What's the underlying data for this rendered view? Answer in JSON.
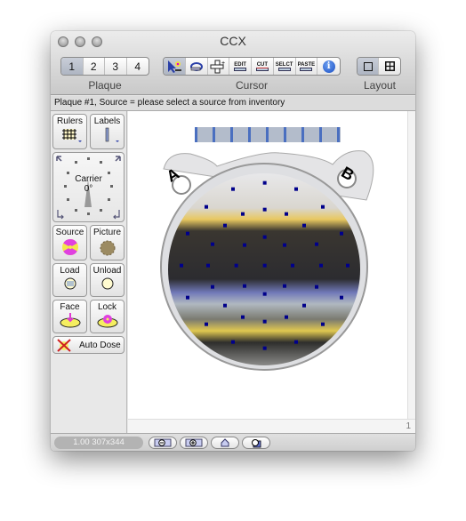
{
  "window": {
    "title": "CCX"
  },
  "toolbar": {
    "plaque": {
      "label": "Plaque",
      "items": [
        "1",
        "2",
        "3",
        "4"
      ],
      "selected": "1"
    },
    "cursor": {
      "label": "Cursor",
      "items": [
        {
          "name": "select-seed-icon"
        },
        {
          "name": "rotate-icon"
        },
        {
          "name": "move-icon"
        },
        {
          "name": "edit-icon",
          "text": "EDIT"
        },
        {
          "name": "cut-icon",
          "text": "CUT"
        },
        {
          "name": "select-icon",
          "text": "SELCT"
        },
        {
          "name": "paste-icon",
          "text": "PASTE"
        },
        {
          "name": "info-icon",
          "text": "i"
        }
      ]
    },
    "layout": {
      "label": "Layout",
      "items": [
        {
          "name": "single-layout-icon"
        },
        {
          "name": "grid-layout-icon"
        }
      ]
    }
  },
  "status": "Plaque #1, Source = please select a source from inventory",
  "left_panel": {
    "rulers": "Rulers",
    "labels": "Labels",
    "carrier": {
      "label": "Carrier",
      "angle": "0°"
    },
    "source": "Source",
    "picture": "Picture",
    "load": "Load",
    "unload": "Unload",
    "face": "Face",
    "lock": "Lock",
    "auto_dose": "Auto Dose"
  },
  "plaque_view": {
    "ear_labels": [
      "A",
      "B"
    ],
    "seed_count": 41,
    "seed_color": "#00008b"
  },
  "scroll": {
    "page": "1"
  },
  "bottom": {
    "zoom_info": "1.00 307x344",
    "buttons": [
      "zoom-out-icon",
      "zoom-in-icon",
      "home-icon",
      "fit-icon"
    ]
  }
}
